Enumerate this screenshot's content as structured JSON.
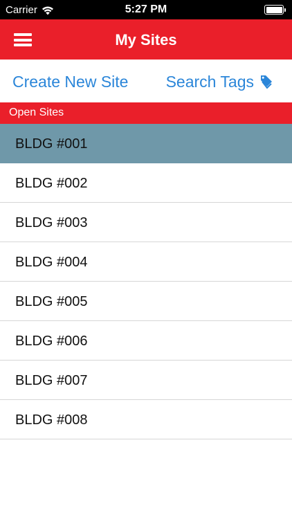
{
  "status_bar": {
    "carrier": "Carrier",
    "time": "5:27 PM",
    "wifi_icon": "wifi-icon",
    "battery_icon": "battery-icon",
    "battery_level": 1.0
  },
  "nav": {
    "title": "My Sites",
    "menu_icon": "hamburger-menu-icon",
    "background_color": "#ea1f2a"
  },
  "actions": {
    "create_label": "Create New Site",
    "search_tags_label": "Search Tags",
    "tag_icon": "tag-icon",
    "link_color": "#2b86d9"
  },
  "section": {
    "title": "Open Sites"
  },
  "sites": [
    {
      "label": "BLDG #001",
      "selected": true
    },
    {
      "label": "BLDG #002",
      "selected": false
    },
    {
      "label": "BLDG #003",
      "selected": false
    },
    {
      "label": "BLDG #004",
      "selected": false
    },
    {
      "label": "BLDG #005",
      "selected": false
    },
    {
      "label": "BLDG #006",
      "selected": false
    },
    {
      "label": "BLDG #007",
      "selected": false
    },
    {
      "label": "BLDG #008",
      "selected": false
    }
  ],
  "colors": {
    "selected_row": "#6f98a9",
    "separator": "#d6d6d6"
  }
}
